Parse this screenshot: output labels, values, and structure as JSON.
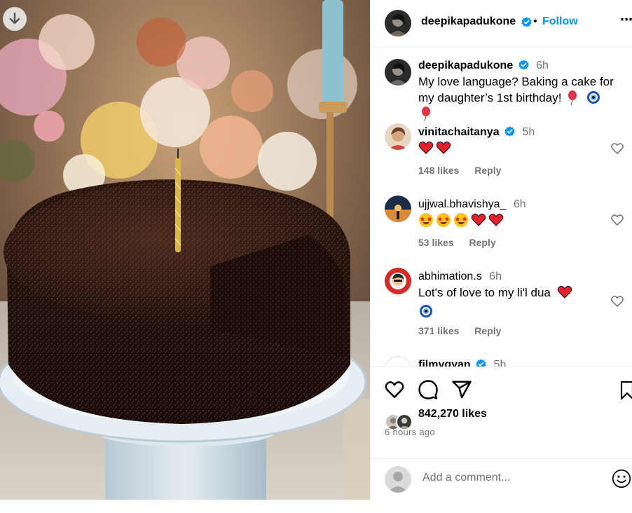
{
  "post": {
    "author": "deepikapadukone",
    "follow_label": "Follow",
    "separator": "•",
    "more_label": "⋯",
    "caption_time": "6h",
    "caption_text": "My love language? Baking a cake for my daughter’s 1st birthday!",
    "caption_emojis": [
      "balloon",
      "nazar-amulet",
      "balloon"
    ],
    "likes_count": "842,270 likes",
    "posted_time": "6 hours ago"
  },
  "comments": [
    {
      "username": "vinitachaitanya",
      "verified": true,
      "time": "5h",
      "emojis": [
        "red-heart",
        "red-heart"
      ],
      "likes": "148 likes",
      "reply_label": "Reply"
    },
    {
      "username": "ujjwal.bhavishya_",
      "verified": false,
      "time": "6h",
      "emojis": [
        "star-struck",
        "star-struck",
        "star-struck",
        "red-heart",
        "red-heart"
      ],
      "likes": "53 likes",
      "reply_label": "Reply"
    },
    {
      "username": "abhimation.s",
      "verified": false,
      "time": "6h",
      "text": "Lot's of love to my li'l dua",
      "emojis": [
        "red-heart",
        "nazar-amulet"
      ],
      "likes": "371 likes",
      "reply_label": "Reply"
    },
    {
      "username": "filmygyan",
      "verified": true,
      "time": "5h"
    }
  ],
  "add_comment": {
    "placeholder": "Add a comment..."
  },
  "colors": {
    "accent": "#0095f6",
    "verified": "#0095f6",
    "muted": "#737373",
    "heart": "#e0245e"
  }
}
